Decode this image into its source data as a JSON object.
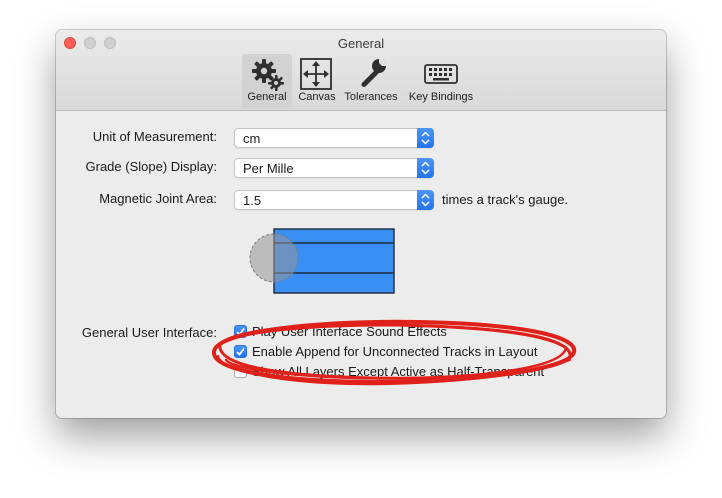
{
  "window": {
    "title": "General"
  },
  "toolbar": {
    "items": [
      {
        "label": "General",
        "icon": "gears-icon",
        "selected": true
      },
      {
        "label": "Canvas",
        "icon": "move-arrows-icon",
        "selected": false
      },
      {
        "label": "Tolerances",
        "icon": "wrench-icon",
        "selected": false
      },
      {
        "label": "Key Bindings",
        "icon": "keyboard-icon",
        "selected": false
      }
    ]
  },
  "settings": {
    "unit": {
      "label": "Unit of Measurement:",
      "value": "cm"
    },
    "grade": {
      "label": "Grade (Slope) Display:",
      "value": "Per Mille"
    },
    "magnetic": {
      "label": "Magnetic Joint Area:",
      "value": "1.5",
      "suffix": "times a track's gauge."
    }
  },
  "ui": {
    "label": "General User Interface:",
    "options": [
      {
        "label": "Play User Interface Sound Effects",
        "checked": true
      },
      {
        "label": "Enable Append for Unconnected Tracks in Layout",
        "checked": true
      },
      {
        "label": "Show All Layers Except Active as Half-Transparent",
        "checked": false
      }
    ]
  },
  "colors": {
    "accent": "#2a7cf3",
    "track_preview": "#3a8ff5",
    "annotation": "#e0201a"
  }
}
